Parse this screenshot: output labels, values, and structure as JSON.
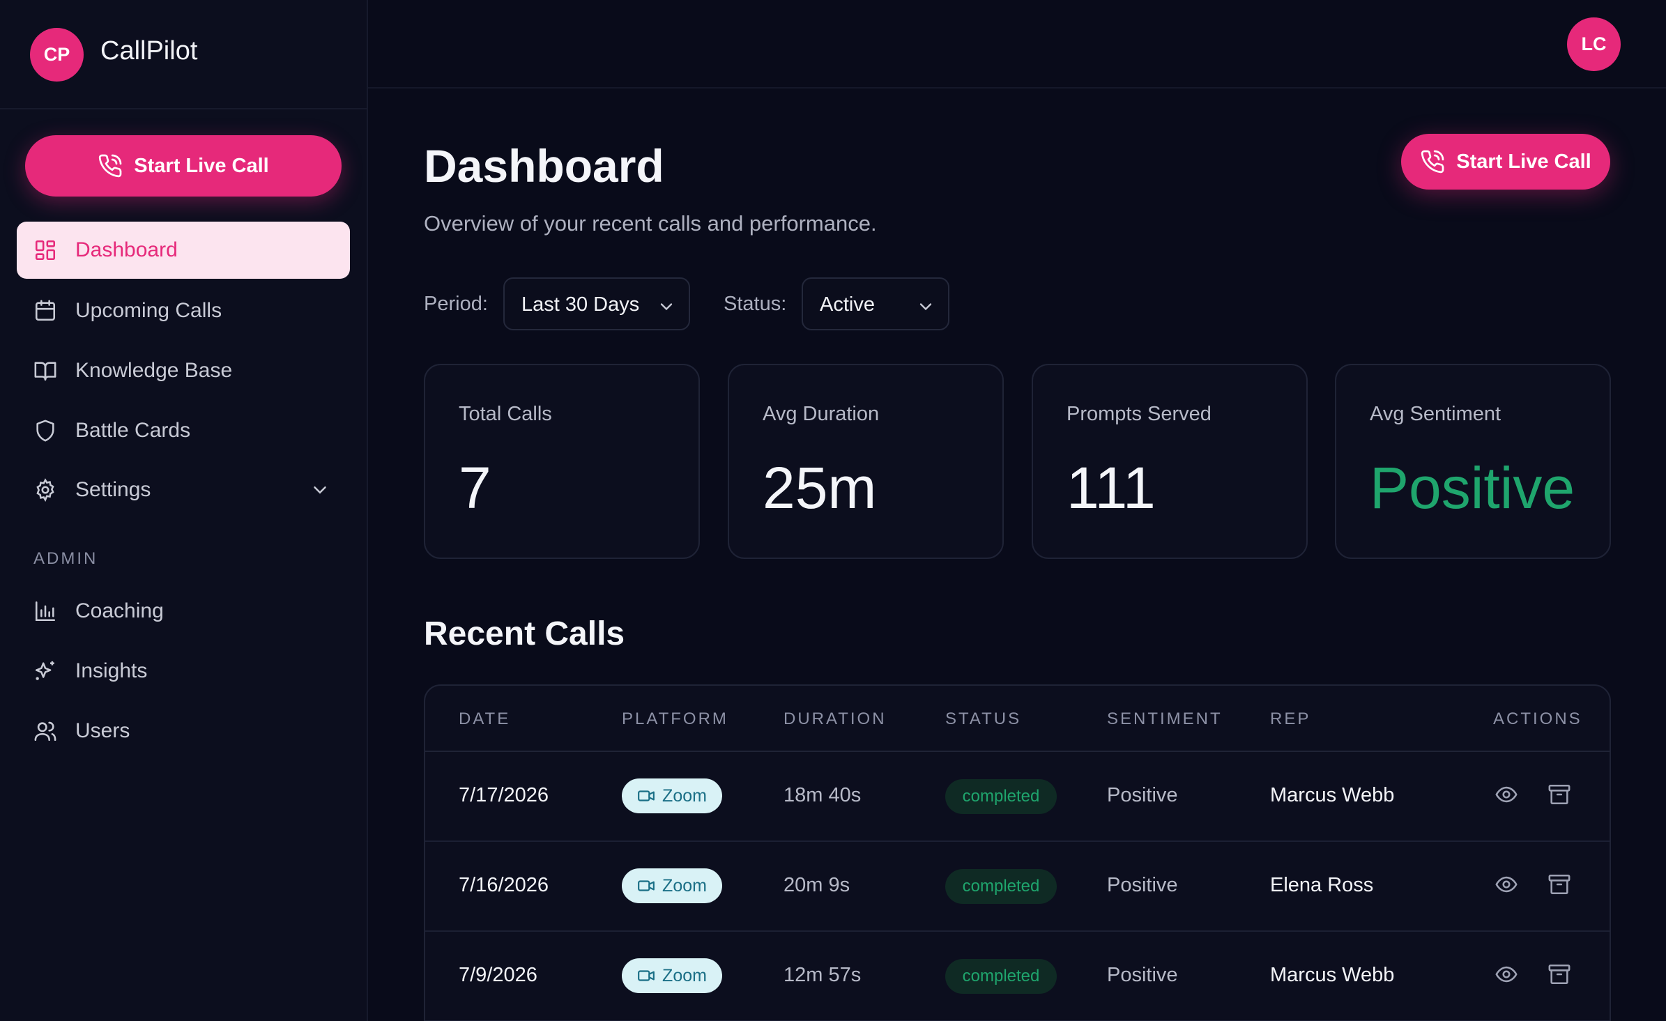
{
  "app": {
    "name": "CallPilot",
    "logo_initials": "CP"
  },
  "sidebar": {
    "start_call_label": "Start Live Call",
    "items": [
      {
        "label": "Dashboard",
        "icon": "grid-icon",
        "active": true
      },
      {
        "label": "Upcoming Calls",
        "icon": "calendar-icon"
      },
      {
        "label": "Knowledge Base",
        "icon": "book-icon"
      },
      {
        "label": "Battle Cards",
        "icon": "shield-icon"
      },
      {
        "label": "Settings",
        "icon": "gear-icon"
      }
    ],
    "admin_label": "ADMIN",
    "admin_items": [
      {
        "label": "Coaching",
        "icon": "bar-chart-icon"
      },
      {
        "label": "Insights",
        "icon": "sparkles-icon"
      },
      {
        "label": "Users",
        "icon": "users-icon"
      }
    ]
  },
  "header": {
    "avatar_initials": "LC"
  },
  "main": {
    "title": "Dashboard",
    "subtitle": "Overview of your recent calls and performance.",
    "start_call_label": "Start Live Call",
    "filters": {
      "period_label": "Period:",
      "period_value": "Last 30 Days",
      "status_label": "Status:",
      "status_value": "Active"
    },
    "stats": [
      {
        "label": "Total Calls",
        "value": "7"
      },
      {
        "label": "Avg Duration",
        "value": "25m"
      },
      {
        "label": "Prompts Served",
        "value": "111"
      },
      {
        "label": "Avg Sentiment",
        "value": "Positive"
      }
    ],
    "recent_title": "Recent Calls",
    "table": {
      "columns": [
        "DATE",
        "PLATFORM",
        "DURATION",
        "STATUS",
        "SENTIMENT",
        "REP",
        "ACTIONS"
      ],
      "rows": [
        {
          "date": "7/17/2026",
          "platform": "Zoom",
          "duration": "18m 40s",
          "status": "completed",
          "sentiment": "Positive",
          "rep": "Marcus Webb"
        },
        {
          "date": "7/16/2026",
          "platform": "Zoom",
          "duration": "20m 9s",
          "status": "completed",
          "sentiment": "Positive",
          "rep": "Elena Ross"
        },
        {
          "date": "7/9/2026",
          "platform": "Zoom",
          "duration": "12m 57s",
          "status": "completed",
          "sentiment": "Positive",
          "rep": "Marcus Webb"
        }
      ]
    }
  },
  "colors": {
    "accent": "#e6297a",
    "positive": "#1fa56d",
    "background": "#090b1a"
  }
}
